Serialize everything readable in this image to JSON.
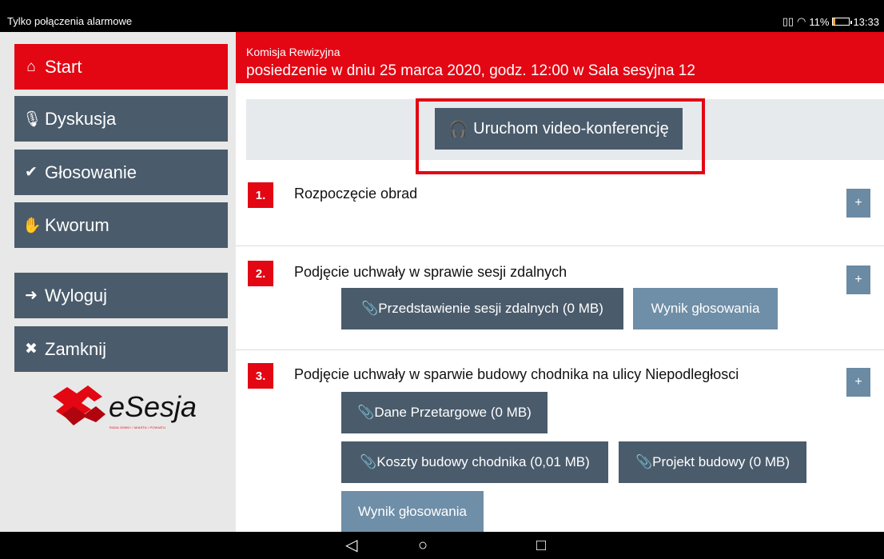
{
  "status_bar": {
    "left_text": "Tylko połączenia alarmowe",
    "right_text": "11%",
    "time": "13:33",
    "battery_level_pct": 11
  },
  "sidebar": {
    "items": [
      {
        "label": "Start",
        "icon": "home-icon"
      },
      {
        "label": "Dyskusja",
        "icon": "microphone-icon"
      },
      {
        "label": "Głosowanie",
        "icon": "check-icon"
      },
      {
        "label": "Kworum",
        "icon": "hand-icon"
      },
      {
        "label": "Wyloguj",
        "icon": "logout-icon"
      },
      {
        "label": "Zamknij",
        "icon": "close-icon"
      }
    ],
    "logo_text": "eSesja",
    "logo_subtext": "RADA GMINY / MIASTA / POWIATU"
  },
  "header": {
    "committee": "Komisja Rewizyjna",
    "meeting": "posiedzenie w dniu 25 marca 2020, godz. 12:00 w Sala sesyjna 12"
  },
  "video_button": {
    "label": "Uruchom video-konferencję",
    "icon": "headphones-icon"
  },
  "agenda": [
    {
      "number": "1.",
      "title": "Rozpoczęcie obrad",
      "plus": "+"
    },
    {
      "number": "2.",
      "title": "Podjęcie uchwały w sprawie sesji zdalnych",
      "plus": "+",
      "buttons": [
        "Przedstawienie sesji zdalnych (0 MB)",
        "Wynik głosowania"
      ]
    },
    {
      "number": "3.",
      "title": "Podjęcie uchwały w sparwie budowy chodnika na ulicy Niepodległosci",
      "plus": "+",
      "buttons": [
        "Dane Przetargowe (0 MB)",
        "Koszty budowy chodnika (0,01 MB)",
        "Projekt budowy (0 MB)",
        "Wynik głosowania"
      ]
    }
  ],
  "colors": {
    "accent": "#e30613",
    "button": "#4a5b6b",
    "button_light": "#6f8ea7",
    "sidebar_bg": "#e8e8e8"
  }
}
